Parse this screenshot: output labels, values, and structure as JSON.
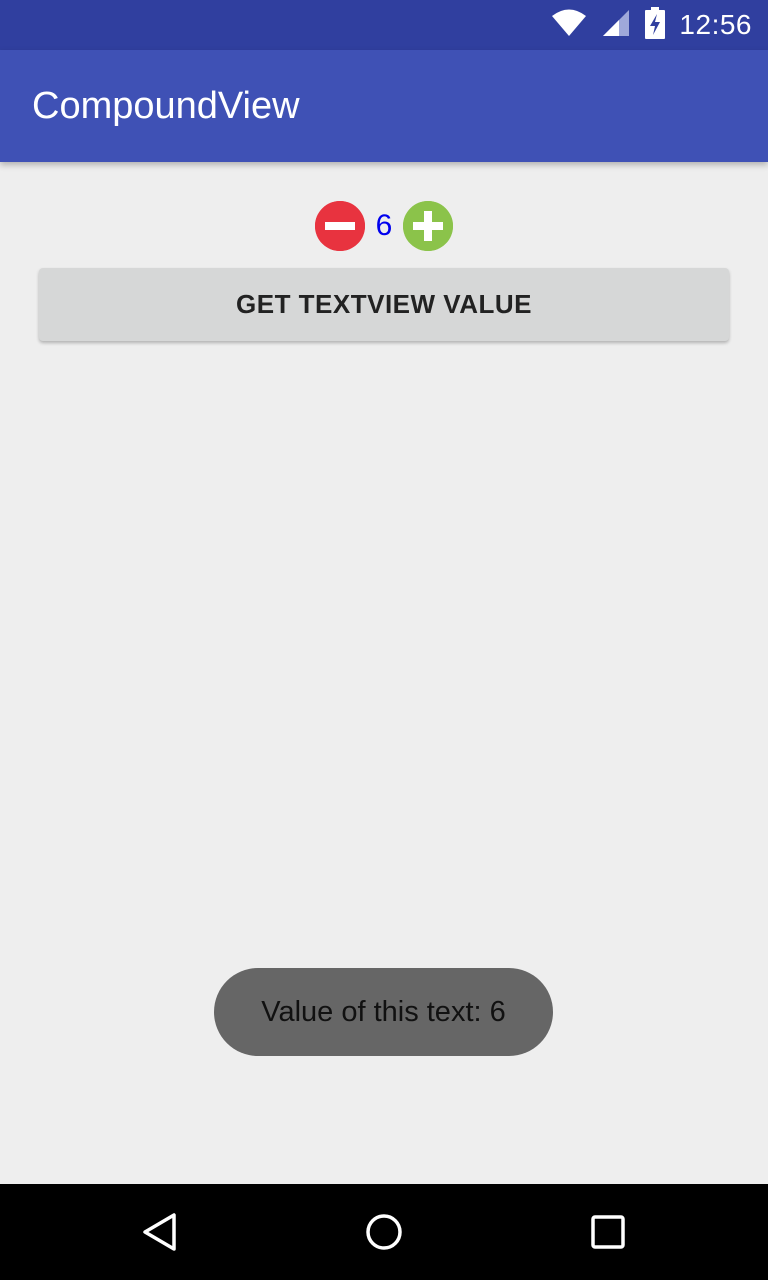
{
  "status_bar": {
    "time": "12:56",
    "icons": [
      "wifi-icon",
      "cell-signal-icon",
      "battery-charging-icon"
    ]
  },
  "app_bar": {
    "title": "CompoundView"
  },
  "counter": {
    "value": "6",
    "decrement_icon": "minus-circle-icon",
    "increment_icon": "plus-circle-icon",
    "decrement_color": "#e8333f",
    "increment_color": "#8bc34a",
    "value_color": "#0000ee"
  },
  "actions": {
    "get_value_label": "GET TEXTVIEW VALUE"
  },
  "toast": {
    "message": "Value of this text: 6"
  },
  "nav_bar": {
    "buttons": [
      "back-icon",
      "home-icon",
      "recents-icon"
    ]
  },
  "colors": {
    "status_bar": "#303f9f",
    "app_bar": "#3f51b5",
    "background": "#eeeeee",
    "button": "#d6d7d7",
    "toast": "#666666"
  }
}
